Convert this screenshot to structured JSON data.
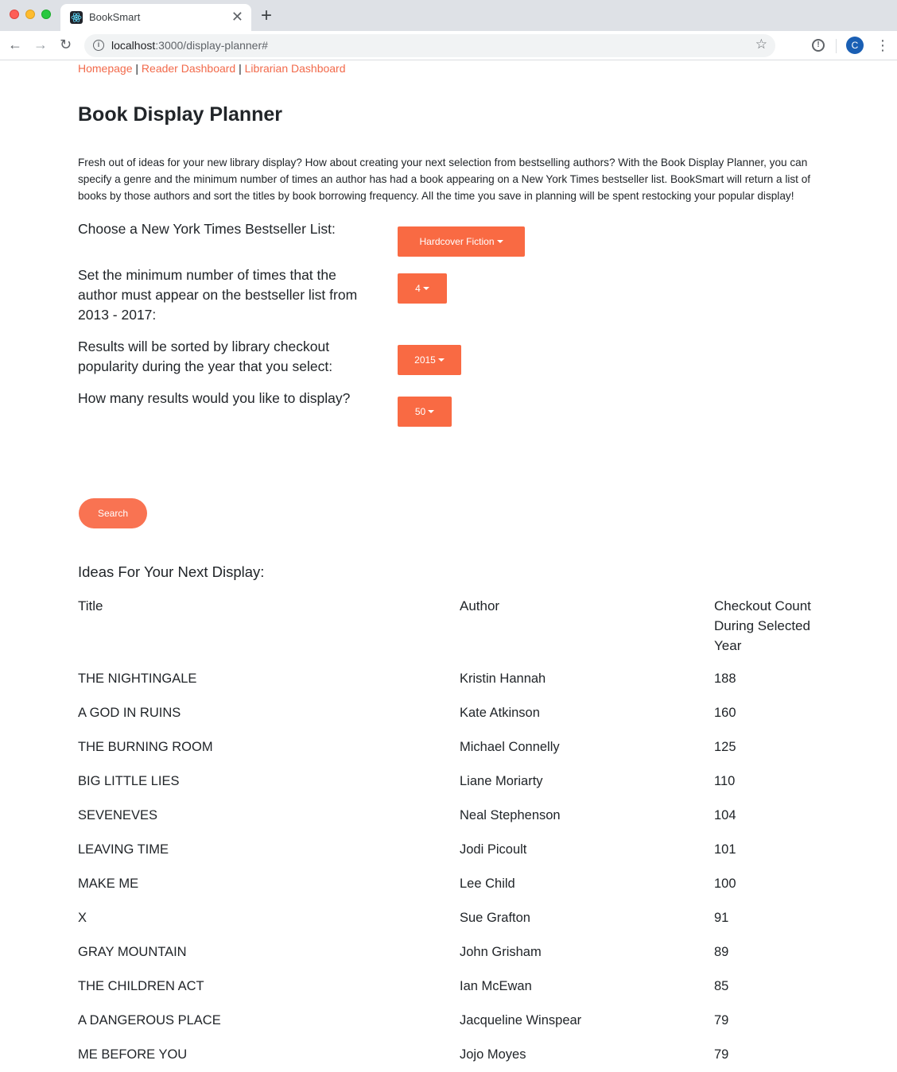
{
  "browser": {
    "tab_title": "BookSmart",
    "url_host": "localhost",
    "url_rest": ":3000/display-planner#",
    "profile_initial": "C"
  },
  "nav": {
    "homepage": "Homepage",
    "reader_dashboard": "Reader Dashboard",
    "librarian_dashboard": "Librarian Dashboard",
    "separator": "|"
  },
  "page": {
    "title": "Book Display Planner",
    "intro": "Fresh out of ideas for your new library display? How about creating your next selection from bestselling authors? With the Book Display Planner, you can specify a genre and the minimum number of times an author has had a book appearing on a New York Times bestseller list. BookSmart will return a list of books by those authors and sort the titles by book borrowing frequency. All the time you save in planning will be spent restocking your popular display!"
  },
  "form": {
    "list_question": "Choose a New York Times Bestseller List:",
    "list_value": "Hardcover Fiction",
    "min_question": "Set the minimum number of times that the author must appear on the bestseller list from 2013 - 2017:",
    "min_value": "4",
    "year_question": "Results will be sorted by library checkout popularity during the year that you select:",
    "year_value": "2015",
    "count_question": "How many results would you like to display?",
    "count_value": "50",
    "search_label": "Search"
  },
  "results": {
    "heading": "Ideas For Your Next Display:",
    "columns": {
      "title": "Title",
      "author": "Author",
      "count": "Checkout Count During Selected Year"
    },
    "rows": [
      {
        "title": "THE NIGHTINGALE",
        "author": "Kristin Hannah",
        "count": "188"
      },
      {
        "title": "A GOD IN RUINS",
        "author": "Kate Atkinson",
        "count": "160"
      },
      {
        "title": "THE BURNING ROOM",
        "author": "Michael Connelly",
        "count": "125"
      },
      {
        "title": "BIG LITTLE LIES",
        "author": "Liane Moriarty",
        "count": "110"
      },
      {
        "title": "SEVENEVES",
        "author": "Neal Stephenson",
        "count": "104"
      },
      {
        "title": "LEAVING TIME",
        "author": "Jodi Picoult",
        "count": "101"
      },
      {
        "title": "MAKE ME",
        "author": "Lee Child",
        "count": "100"
      },
      {
        "title": "X",
        "author": "Sue Grafton",
        "count": "91"
      },
      {
        "title": "GRAY MOUNTAIN",
        "author": "John Grisham",
        "count": "89"
      },
      {
        "title": "THE CHILDREN ACT",
        "author": "Ian McEwan",
        "count": "85"
      },
      {
        "title": "A DANGEROUS PLACE",
        "author": "Jacqueline Winspear",
        "count": "79"
      },
      {
        "title": "ME BEFORE YOU",
        "author": "Jojo Moyes",
        "count": "79"
      }
    ]
  }
}
